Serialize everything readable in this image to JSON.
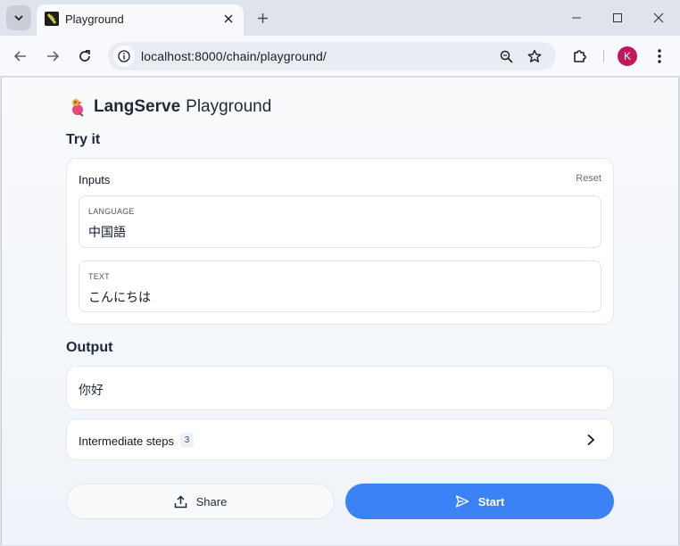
{
  "browser": {
    "tab_title": "Playground",
    "url": "localhost:8000/chain/playground/",
    "profile_initial": "K"
  },
  "app": {
    "brand_bold": "LangServe",
    "brand_light": "Playground"
  },
  "sections": {
    "try_it": "Try it",
    "output": "Output"
  },
  "inputs": {
    "title": "Inputs",
    "reset_label": "Reset",
    "fields": [
      {
        "label": "LANGUAGE",
        "value": "中国語"
      },
      {
        "label": "TEXT",
        "value": "こんにちは"
      }
    ]
  },
  "output": {
    "value": "你好"
  },
  "intermediate_steps": {
    "label": "Intermediate steps",
    "count": "3"
  },
  "actions": {
    "share_label": "Share",
    "start_label": "Start"
  },
  "colors": {
    "accent": "#3b82f6",
    "avatar": "#c2185b"
  }
}
